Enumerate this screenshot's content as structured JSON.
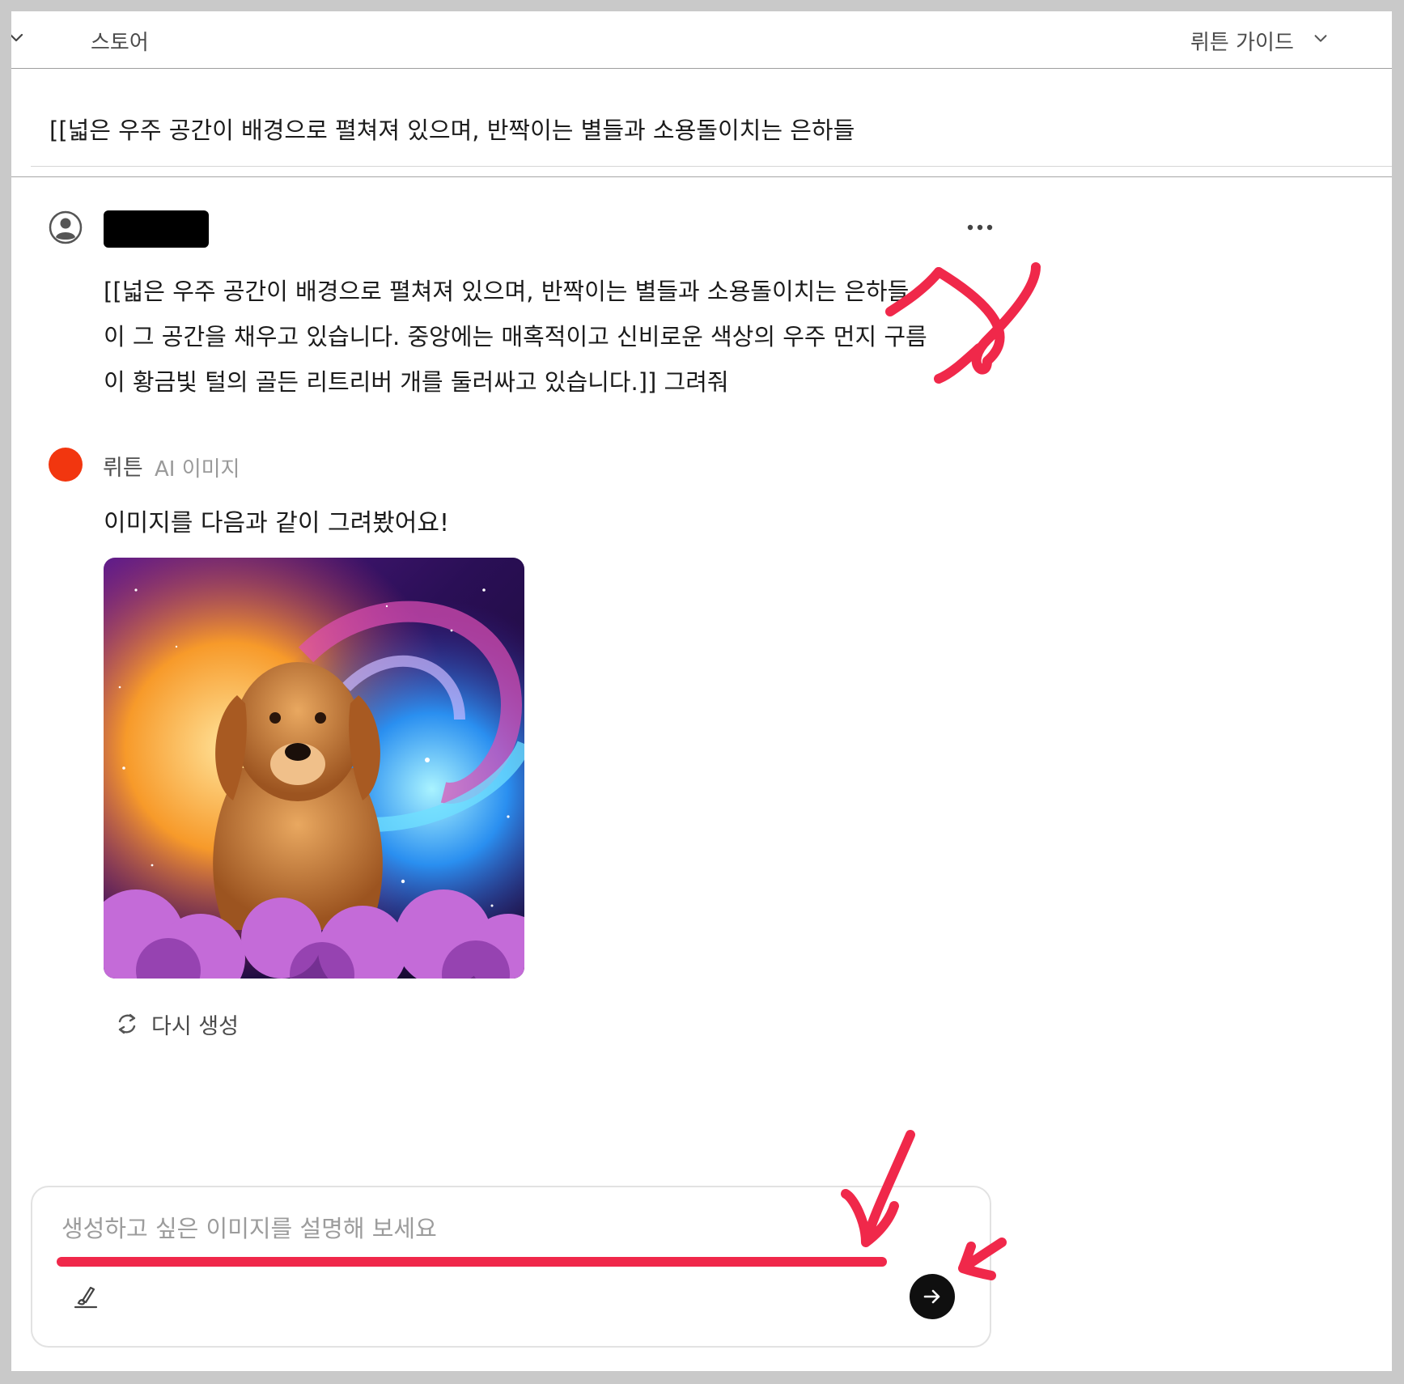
{
  "topbar": {
    "store_label": "스토어",
    "guide_label": "뤼튼 가이드",
    "icons": {
      "left": "chevron-down-icon",
      "guide": "chevron-down-icon",
      "account": "user-avatar-icon"
    }
  },
  "chat_title": "[[넓은 우주 공간이 배경으로 펼쳐져 있으며, 반짝이는 별들과 소용돌이치는 은하들",
  "user_message": {
    "author_redacted": true,
    "more_icon": "more-dots-icon",
    "lines": [
      "[[넓은 우주 공간이 배경으로 펼쳐져 있으며, 반짝이는 별들과 소용돌이치는 은하들",
      "이 그 공간을 채우고 있습니다. 중앙에는 매혹적이고 신비로운 색상의 우주 먼지 구름",
      "이 황금빛 털의 골든 리트리버 개를 둘러싸고 있습니다.]] 그려줘"
    ]
  },
  "bot_message": {
    "name": "뤼튼",
    "tag": "AI 이미지",
    "text": "이미지를 다음과 같이 그려봤어요!",
    "image_icon": "generated-image",
    "regenerate_label": "다시 생성",
    "regenerate_icon": "refresh-icon"
  },
  "composer": {
    "placeholder": "생성하고 싶은 이미지를 설명해 보세요",
    "value": "",
    "left_icon": "brush-icon",
    "send_icon": "arrow-right-icon"
  },
  "colors": {
    "accent_red": "#f2360f",
    "annotation_red": "#f0284a",
    "send_button": "#0f0f0f"
  }
}
